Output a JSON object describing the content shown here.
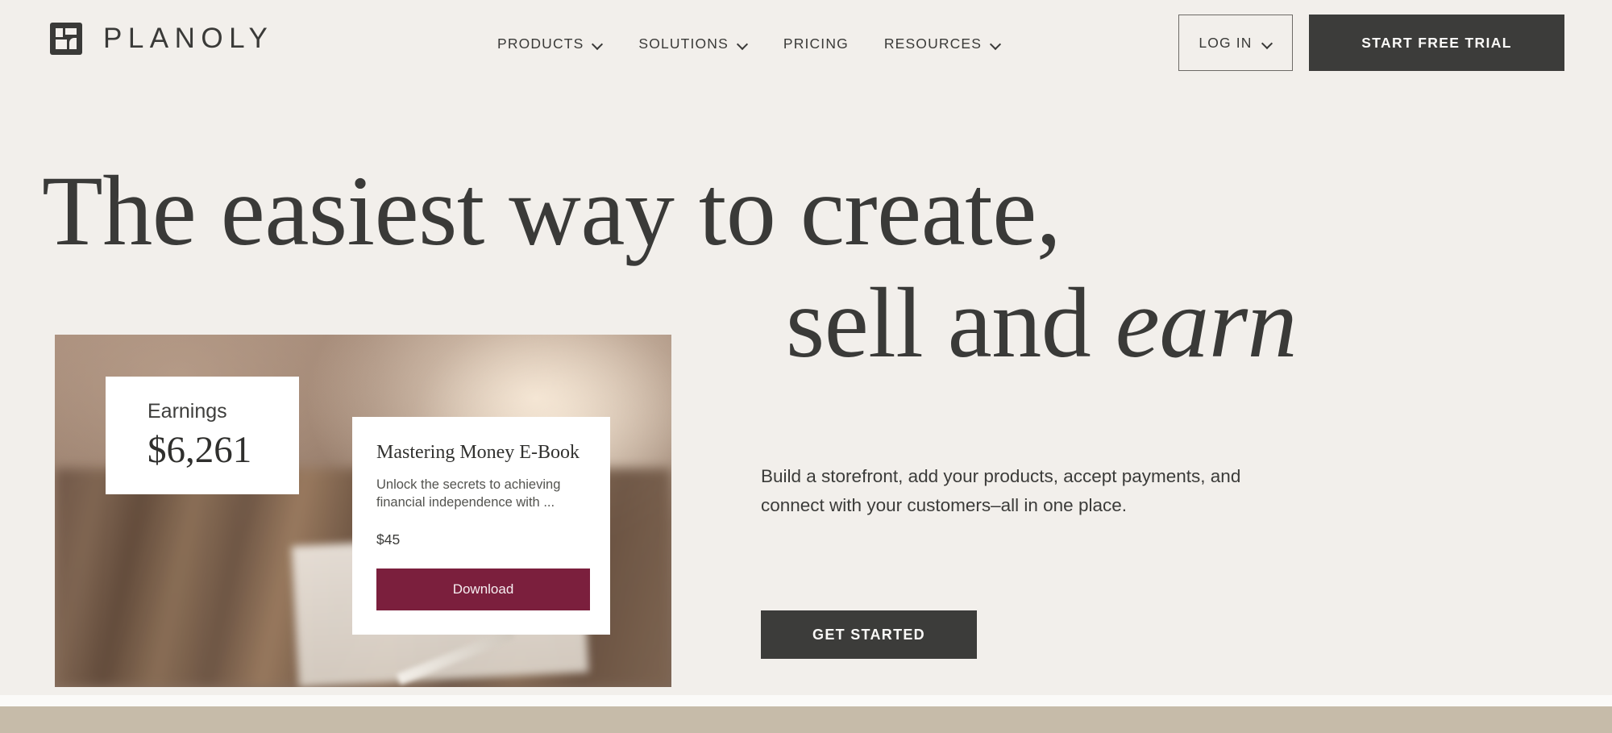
{
  "brand": {
    "wordmark": "PLANOLY",
    "logo_icon": "planoly-grid-logo-icon",
    "mark_color": "#3a3a38"
  },
  "nav": {
    "items": [
      {
        "label": "PRODUCTS",
        "has_dropdown": true,
        "icon": "chevron-down-icon"
      },
      {
        "label": "SOLUTIONS",
        "has_dropdown": true,
        "icon": "chevron-down-icon"
      },
      {
        "label": "PRICING",
        "has_dropdown": false,
        "icon": ""
      },
      {
        "label": "RESOURCES",
        "has_dropdown": true,
        "icon": "chevron-down-icon"
      }
    ]
  },
  "header_actions": {
    "login_label": "LOG IN",
    "login_icon": "chevron-down-icon",
    "trial_label": "START FREE TRIAL",
    "trial_bg": "#3c3c3a"
  },
  "hero": {
    "headline_line1": "The easiest way to create,",
    "headline_line2_plain": "sell and ",
    "headline_line2_em": "earn",
    "body": "Build a storefront, add your products, accept payments, and connect with your customers–all in one place.",
    "cta_label": "GET STARTED",
    "cta_bg": "#3c3c3a",
    "text_color": "#3a3a38"
  },
  "visual": {
    "earnings_card": {
      "label": "Earnings",
      "amount": "$6,261"
    },
    "product_card": {
      "title": "Mastering Money E-Book",
      "description": "Unlock the secrets to achieving financial independence with ...",
      "price": "$45",
      "button_label": "Download",
      "button_bg": "#7b1f3d"
    }
  },
  "theme": {
    "page_bg": "#f2efeb",
    "footer_band": "#c6bba9"
  }
}
